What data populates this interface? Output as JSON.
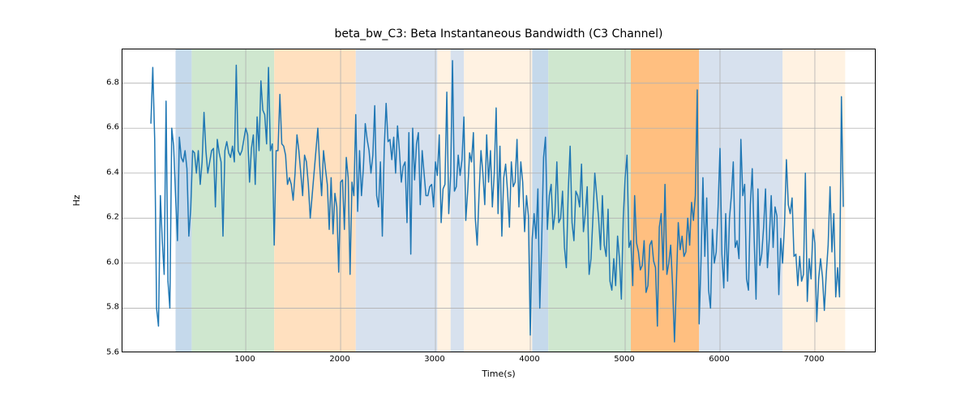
{
  "chart_data": {
    "type": "line",
    "title": "beta_bw_C3: Beta Instantaneous Bandwidth (C3 Channel)",
    "xlabel": "Time(s)",
    "ylabel": "Hz",
    "xlim": [
      -300,
      7650
    ],
    "ylim": [
      5.6,
      6.95
    ],
    "xticks": [
      1000,
      2000,
      3000,
      4000,
      5000,
      6000,
      7000
    ],
    "yticks": [
      5.6,
      5.8,
      6.0,
      6.2,
      6.4,
      6.6,
      6.8
    ],
    "regions": [
      {
        "start": 260,
        "end": 430,
        "color": "#c5d9eb"
      },
      {
        "start": 430,
        "end": 1300,
        "color": "#cfe7cf"
      },
      {
        "start": 1300,
        "end": 2160,
        "color": "#ffe0bf"
      },
      {
        "start": 2160,
        "end": 3020,
        "color": "#d7e1ee"
      },
      {
        "start": 3020,
        "end": 3160,
        "color": "#fff2e2"
      },
      {
        "start": 3160,
        "end": 3300,
        "color": "#d7e1ee"
      },
      {
        "start": 3300,
        "end": 4020,
        "color": "#fff2e2"
      },
      {
        "start": 4020,
        "end": 4190,
        "color": "#c5d9eb"
      },
      {
        "start": 4190,
        "end": 5060,
        "color": "#cfe7cf"
      },
      {
        "start": 5060,
        "end": 5780,
        "color": "#ffbf80"
      },
      {
        "start": 5780,
        "end": 6660,
        "color": "#d7e1ee"
      },
      {
        "start": 6660,
        "end": 7320,
        "color": "#fff2e2"
      }
    ],
    "series": [
      {
        "name": "beta_bw_C3",
        "color": "#1f77b4",
        "x_step": 20,
        "x_start": 0,
        "values": [
          6.62,
          6.87,
          6.55,
          5.8,
          5.72,
          6.3,
          6.1,
          5.95,
          6.72,
          5.92,
          5.8,
          6.6,
          6.52,
          6.3,
          6.1,
          6.56,
          6.47,
          6.45,
          6.5,
          6.42,
          6.12,
          6.24,
          6.5,
          6.49,
          6.4,
          6.5,
          6.35,
          6.45,
          6.67,
          6.5,
          6.4,
          6.45,
          6.5,
          6.51,
          6.25,
          6.55,
          6.49,
          6.45,
          6.12,
          6.5,
          6.54,
          6.49,
          6.47,
          6.52,
          6.45,
          6.88,
          6.5,
          6.48,
          6.5,
          6.55,
          6.6,
          6.57,
          6.36,
          6.51,
          6.57,
          6.35,
          6.65,
          6.5,
          6.81,
          6.68,
          6.66,
          6.53,
          6.87,
          6.5,
          6.53,
          6.08,
          6.5,
          6.5,
          6.75,
          6.53,
          6.52,
          6.48,
          6.35,
          6.38,
          6.35,
          6.28,
          6.4,
          6.57,
          6.5,
          6.4,
          6.3,
          6.48,
          6.45,
          6.35,
          6.2,
          6.3,
          6.4,
          6.5,
          6.6,
          6.43,
          6.3,
          6.5,
          6.42,
          6.35,
          6.15,
          6.38,
          6.13,
          6.31,
          6.25,
          5.96,
          6.36,
          6.37,
          6.15,
          6.47,
          6.38,
          5.95,
          6.36,
          6.3,
          6.66,
          6.23,
          6.5,
          6.3,
          6.42,
          6.62,
          6.55,
          6.5,
          6.4,
          6.48,
          6.7,
          6.3,
          6.25,
          6.45,
          6.12,
          6.51,
          6.71,
          6.54,
          6.55,
          6.46,
          6.56,
          6.4,
          6.61,
          6.5,
          6.36,
          6.43,
          6.45,
          6.18,
          6.58,
          6.04,
          6.6,
          6.37,
          6.53,
          6.58,
          6.26,
          6.5,
          6.4,
          6.3,
          6.3,
          6.34,
          6.35,
          6.25,
          6.45,
          6.39,
          6.57,
          6.18,
          6.33,
          6.35,
          6.76,
          6.22,
          6.39,
          6.9,
          6.32,
          6.34,
          6.48,
          6.39,
          6.46,
          6.65,
          6.19,
          6.32,
          6.49,
          6.45,
          6.58,
          6.2,
          6.08,
          6.31,
          6.5,
          6.4,
          6.26,
          6.57,
          6.36,
          6.5,
          6.25,
          6.4,
          6.69,
          6.22,
          6.52,
          6.12,
          6.38,
          6.44,
          6.32,
          6.16,
          6.45,
          6.34,
          6.36,
          6.55,
          6.25,
          6.45,
          6.36,
          6.14,
          6.3,
          6.21,
          5.68,
          6.11,
          6.22,
          6.11,
          6.33,
          5.8,
          6.1,
          6.47,
          6.56,
          6.15,
          6.3,
          6.35,
          6.15,
          6.22,
          6.45,
          6.18,
          6.2,
          6.32,
          6.07,
          5.98,
          6.32,
          6.52,
          6.18,
          6.1,
          6.32,
          6.3,
          6.25,
          6.44,
          6.14,
          6.22,
          6.34,
          5.95,
          6.02,
          6.2,
          6.4,
          6.3,
          6.2,
          6.06,
          6.3,
          6.08,
          6.03,
          6.24,
          5.92,
          5.88,
          6.02,
          5.9,
          6.12,
          6.02,
          5.84,
          6.2,
          6.38,
          6.48,
          6.07,
          6.1,
          5.9,
          6.3,
          6.09,
          6.05,
          5.97,
          5.99,
          6.1,
          5.87,
          5.9,
          6.08,
          6.1,
          6.01,
          5.98,
          5.72,
          6.16,
          6.22,
          5.97,
          6.35,
          5.95,
          6.0,
          6.08,
          5.9,
          5.65,
          5.91,
          6.18,
          6.06,
          6.12,
          6.03,
          6.05,
          6.2,
          6.08,
          6.27,
          6.19,
          6.3,
          6.77,
          5.73,
          6.01,
          6.38,
          6.03,
          6.29,
          5.88,
          5.8,
          6.15,
          6.0,
          6.05,
          6.25,
          6.51,
          6.04,
          5.89,
          6.22,
          5.92,
          6.2,
          6.3,
          6.45,
          6.07,
          6.1,
          6.02,
          6.55,
          6.3,
          6.35,
          5.93,
          5.88,
          6.26,
          6.42,
          6.11,
          5.84,
          6.33,
          5.99,
          6.04,
          6.16,
          6.33,
          5.98,
          6.11,
          6.3,
          6.07,
          6.25,
          6.21,
          5.86,
          6.11,
          6.0,
          6.17,
          6.46,
          6.26,
          6.22,
          6.29,
          6.03,
          6.04,
          5.9,
          6.03,
          5.92,
          5.95,
          6.4,
          5.83,
          6.02,
          5.93,
          6.15,
          6.09,
          5.74,
          5.93,
          6.02,
          5.94,
          5.79,
          5.95,
          6.08,
          6.34,
          6.05,
          6.22,
          5.85,
          5.98,
          5.85,
          6.74,
          6.25
        ]
      }
    ]
  }
}
